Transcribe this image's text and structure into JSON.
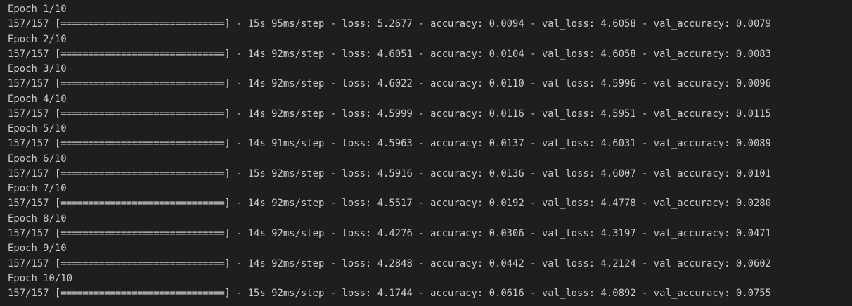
{
  "log": {
    "epochs": [
      {
        "header": "Epoch 1/10",
        "steps": "157/157",
        "bar": "==============================",
        "time": "15s",
        "per_step": "95ms/step",
        "loss": "5.2677",
        "accuracy": "0.0094",
        "val_loss": "4.6058",
        "val_accuracy": "0.0079"
      },
      {
        "header": "Epoch 2/10",
        "steps": "157/157",
        "bar": "==============================",
        "time": "14s",
        "per_step": "92ms/step",
        "loss": "4.6051",
        "accuracy": "0.0104",
        "val_loss": "4.6058",
        "val_accuracy": "0.0083"
      },
      {
        "header": "Epoch 3/10",
        "steps": "157/157",
        "bar": "==============================",
        "time": "14s",
        "per_step": "92ms/step",
        "loss": "4.6022",
        "accuracy": "0.0110",
        "val_loss": "4.5996",
        "val_accuracy": "0.0096"
      },
      {
        "header": "Epoch 4/10",
        "steps": "157/157",
        "bar": "==============================",
        "time": "14s",
        "per_step": "92ms/step",
        "loss": "4.5999",
        "accuracy": "0.0116",
        "val_loss": "4.5951",
        "val_accuracy": "0.0115"
      },
      {
        "header": "Epoch 5/10",
        "steps": "157/157",
        "bar": "==============================",
        "time": "14s",
        "per_step": "91ms/step",
        "loss": "4.5963",
        "accuracy": "0.0137",
        "val_loss": "4.6031",
        "val_accuracy": "0.0089"
      },
      {
        "header": "Epoch 6/10",
        "steps": "157/157",
        "bar": "==============================",
        "time": "15s",
        "per_step": "92ms/step",
        "loss": "4.5916",
        "accuracy": "0.0136",
        "val_loss": "4.6007",
        "val_accuracy": "0.0101"
      },
      {
        "header": "Epoch 7/10",
        "steps": "157/157",
        "bar": "==============================",
        "time": "14s",
        "per_step": "92ms/step",
        "loss": "4.5517",
        "accuracy": "0.0192",
        "val_loss": "4.4778",
        "val_accuracy": "0.0280"
      },
      {
        "header": "Epoch 8/10",
        "steps": "157/157",
        "bar": "==============================",
        "time": "14s",
        "per_step": "92ms/step",
        "loss": "4.4276",
        "accuracy": "0.0306",
        "val_loss": "4.3197",
        "val_accuracy": "0.0471"
      },
      {
        "header": "Epoch 9/10",
        "steps": "157/157",
        "bar": "==============================",
        "time": "14s",
        "per_step": "92ms/step",
        "loss": "4.2848",
        "accuracy": "0.0442",
        "val_loss": "4.2124",
        "val_accuracy": "0.0602"
      },
      {
        "header": "Epoch 10/10",
        "steps": "157/157",
        "bar": "==============================",
        "time": "15s",
        "per_step": "92ms/step",
        "loss": "4.1744",
        "accuracy": "0.0616",
        "val_loss": "4.0892",
        "val_accuracy": "0.0755"
      }
    ]
  },
  "colors": {
    "background": "#1e1e1e",
    "text": "#cccccc"
  }
}
